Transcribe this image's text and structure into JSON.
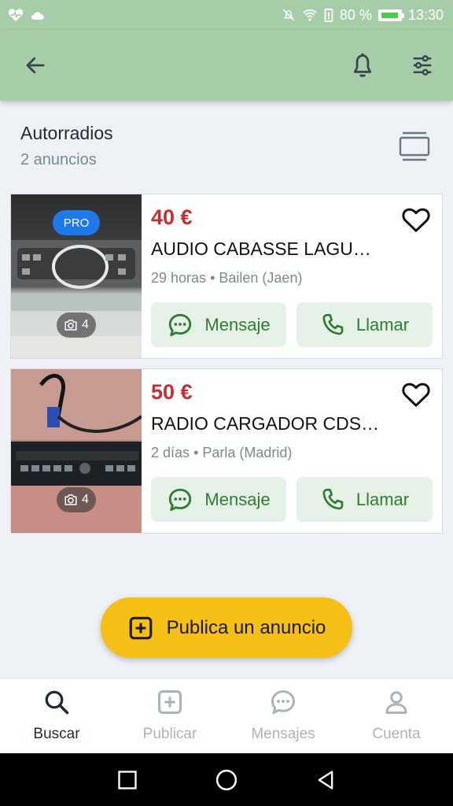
{
  "status_bar": {
    "battery_text": "80 %",
    "time": "13:30"
  },
  "colors": {
    "appbar_bg": "#a7cca8",
    "accent_green": "#2e7d32",
    "price_red": "#c2302f",
    "fab_yellow": "#f6bf16",
    "pro_blue": "#1e7ae8"
  },
  "header": {
    "category": "Autorradios",
    "count": "2 anuncios"
  },
  "listings": [
    {
      "price": "40 €",
      "title": "AUDIO  CABASSE LAGU…",
      "time": "29 horas",
      "location": "Bailen (Jaen)",
      "badge": "PRO",
      "photo_count": "4",
      "message_label": "Mensaje",
      "call_label": "Llamar"
    },
    {
      "price": "50 €",
      "title": "RADIO CARGADOR CDS…",
      "time": "2 días",
      "location": "Parla (Madrid)",
      "photo_count": "4",
      "message_label": "Mensaje",
      "call_label": "Llamar"
    }
  ],
  "fab": {
    "label": "Publica un anuncio"
  },
  "bottom_nav": [
    {
      "label": "Buscar",
      "icon": "search-icon",
      "active": true
    },
    {
      "label": "Publicar",
      "icon": "plus-square-icon",
      "active": false
    },
    {
      "label": "Mensajes",
      "icon": "chat-icon",
      "active": false
    },
    {
      "label": "Cuenta",
      "icon": "user-icon",
      "active": false
    }
  ],
  "icons": {
    "appbar": [
      "back-arrow-icon",
      "bell-icon",
      "filters-icon"
    ],
    "view_toggle": "list-view-icon",
    "favorite": "heart-icon",
    "camera": "camera-icon"
  }
}
